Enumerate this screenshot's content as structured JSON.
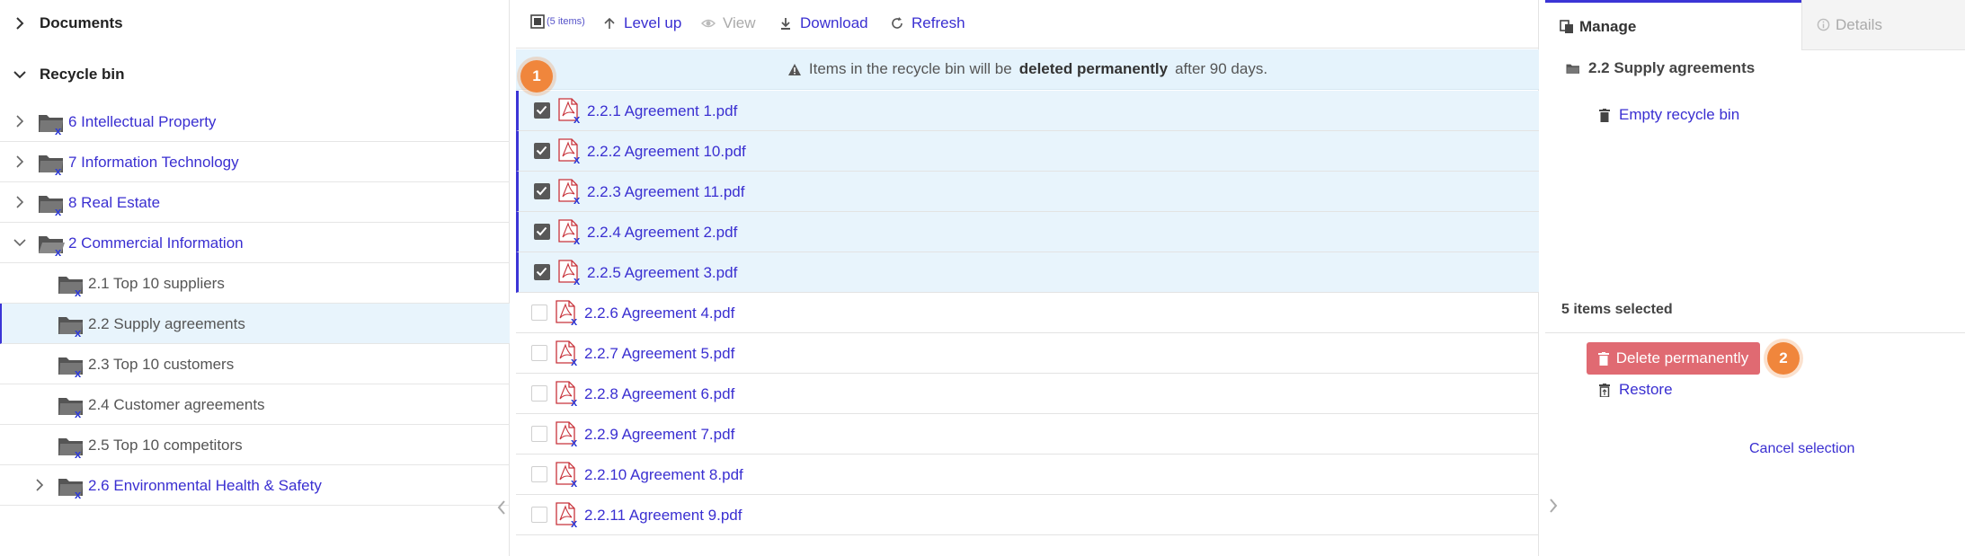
{
  "tree": {
    "documents_label": "Documents",
    "recycle_label": "Recycle bin",
    "items": [
      {
        "label": "6 Intellectual Property",
        "state": "collapsed",
        "level": 0
      },
      {
        "label": "7 Information Technology",
        "state": "collapsed",
        "level": 0
      },
      {
        "label": "8 Real Estate",
        "state": "collapsed",
        "level": 0
      },
      {
        "label": "2 Commercial Information",
        "state": "expanded",
        "level": 0
      },
      {
        "label": "2.1 Top 10 suppliers",
        "level": 1
      },
      {
        "label": "2.2 Supply agreements",
        "level": 1,
        "selected": true
      },
      {
        "label": "2.3 Top 10 customers",
        "level": 1
      },
      {
        "label": "2.4 Customer agreements",
        "level": 1
      },
      {
        "label": "2.5 Top 10 competitors",
        "level": 1
      },
      {
        "label": "2.6 Environmental Health & Safety",
        "state": "collapsed",
        "level": 1
      }
    ],
    "deleted_marker": "x"
  },
  "toolbar": {
    "count": "(5 items)",
    "level_up": "Level up",
    "view": "View",
    "download": "Download",
    "refresh": "Refresh"
  },
  "notice": {
    "before": "Items in the recycle bin will be",
    "bold": "deleted permanently",
    "after": "after 90 days."
  },
  "files": [
    {
      "name": "2.2.1 Agreement 1.pdf",
      "checked": true
    },
    {
      "name": "2.2.2 Agreement 10.pdf",
      "checked": true
    },
    {
      "name": "2.2.3 Agreement 11.pdf",
      "checked": true
    },
    {
      "name": "2.2.4 Agreement 2.pdf",
      "checked": true
    },
    {
      "name": "2.2.5 Agreement 3.pdf",
      "checked": true
    },
    {
      "name": "2.2.6 Agreement 4.pdf",
      "checked": false
    },
    {
      "name": "2.2.7 Agreement 5.pdf",
      "checked": false
    },
    {
      "name": "2.2.8 Agreement 6.pdf",
      "checked": false
    },
    {
      "name": "2.2.9 Agreement 7.pdf",
      "checked": false
    },
    {
      "name": "2.2.10 Agreement 8.pdf",
      "checked": false
    },
    {
      "name": "2.2.11 Agreement 9.pdf",
      "checked": false
    }
  ],
  "badges": {
    "one": "1",
    "two": "2"
  },
  "panel": {
    "tab_manage": "Manage",
    "tab_details": "Details",
    "folder": "2.2 Supply agreements",
    "empty_bin": "Empty recycle bin",
    "selected_count": "5 items selected",
    "delete_permanently": "Delete permanently",
    "restore": "Restore",
    "cancel_selection": "Cancel selection"
  },
  "colors": {
    "accent": "#3b34d6",
    "link": "#3a2fd1",
    "danger": "#e06a72",
    "badge": "#f0863c",
    "selected_bg": "#e8f4fc"
  }
}
